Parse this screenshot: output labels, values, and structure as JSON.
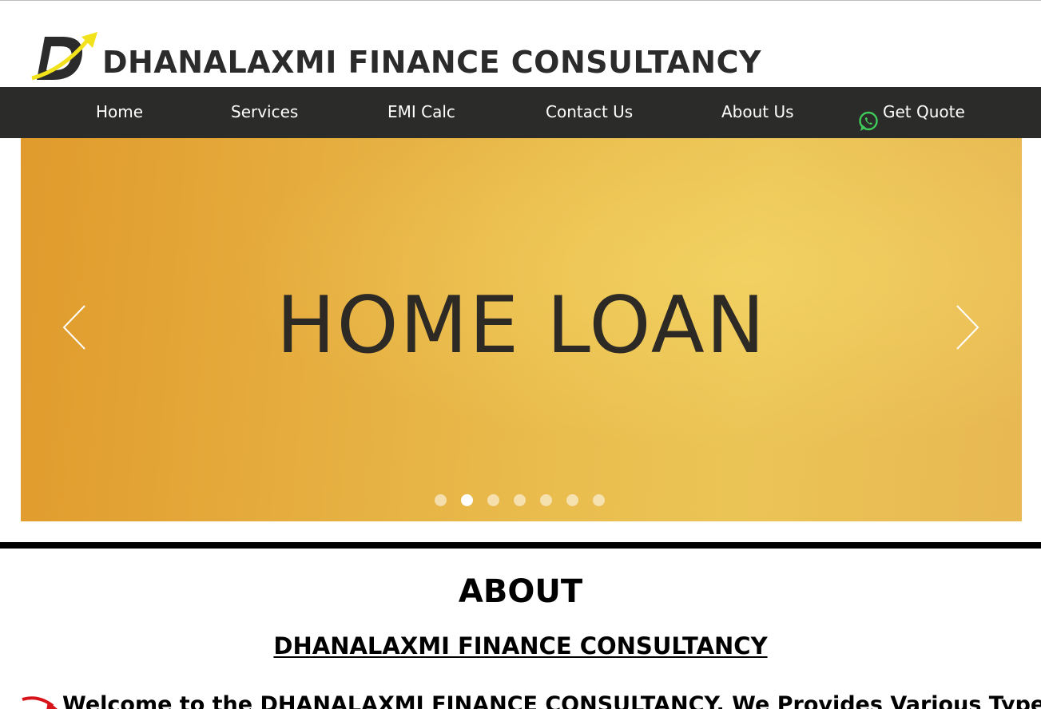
{
  "brand": {
    "title": "DHANALAXMI FINANCE CONSULTANCY",
    "logo_letter": "D",
    "logo_colors": {
      "letter": "#2b2b2b",
      "arrow": "#f2e21b"
    }
  },
  "nav": {
    "items": [
      {
        "label": "Home"
      },
      {
        "label": "Services"
      },
      {
        "label": "EMI Calc"
      },
      {
        "label": "Contact Us"
      },
      {
        "label": "About Us"
      },
      {
        "label": "Get Quote",
        "icon": "whatsapp-icon"
      }
    ],
    "background": "#2b2c29"
  },
  "slider": {
    "slide_text": "HOME LOAN",
    "prev_icon": "chevron-left-icon",
    "next_icon": "chevron-right-icon",
    "dots_total": 7,
    "active_dot": 2,
    "background": "#e5aa3c"
  },
  "about": {
    "heading": "ABOUT",
    "subheading": "DHANALAXMI FINANCE CONSULTANCY",
    "welcome_text": "Welcome to the DHANALAXMI FINANCE CONSULTANCY. We Provides Various Types",
    "pointer_icon": "red-arrow-pointer-icon"
  }
}
